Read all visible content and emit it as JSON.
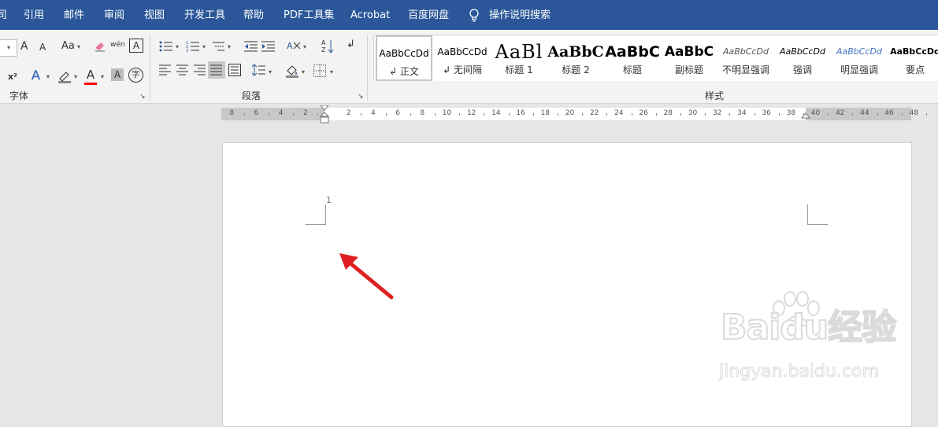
{
  "tabs": [
    "司",
    "引用",
    "邮件",
    "审阅",
    "视图",
    "开发工具",
    "帮助",
    "PDF工具集",
    "Acrobat",
    "百度网盘"
  ],
  "tell_me": "操作说明搜索",
  "groups": {
    "font": "字体",
    "paragraph": "段落",
    "styles": "样式"
  },
  "styles": [
    {
      "sample": "AaBbCcDd",
      "name": "↲ 正文"
    },
    {
      "sample": "AaBbCcDd",
      "name": "↲ 无间隔"
    },
    {
      "sample": "AaBl",
      "name": "标题 1"
    },
    {
      "sample": "AaBbC",
      "name": "标题 2"
    },
    {
      "sample": "AaBbC",
      "name": "标题"
    },
    {
      "sample": "AaBbC",
      "name": "副标题"
    },
    {
      "sample": "AaBbCcDd",
      "name": "不明显强调"
    },
    {
      "sample": "AaBbCcDd",
      "name": "强调"
    },
    {
      "sample": "AaBbCcDd",
      "name": "明显强调"
    },
    {
      "sample": "AaBbCcDd",
      "name": "要点"
    }
  ],
  "ruler_labels": [
    "8",
    "6",
    "4",
    "2",
    "2",
    "4",
    "6",
    "8",
    "10",
    "12",
    "14",
    "16",
    "18",
    "20",
    "22",
    "24",
    "26",
    "28",
    "30",
    "32",
    "34",
    "36",
    "38",
    "40",
    "42",
    "44",
    "46",
    "48"
  ],
  "page_number": "1",
  "font_icons": {
    "grow": "A",
    "shrink": "A",
    "case": "Aa",
    "superscript": "x²",
    "phonetic": "wén",
    "char_border": "A",
    "font_color": "A",
    "char_shading": "A",
    "enclose": "字"
  },
  "watermark": {
    "logo": "Baidu经验",
    "url": "jingyan.baidu.com"
  },
  "colors": {
    "ribbon_blue": "#2b579a",
    "font_color_red": "#ff0000",
    "arrow_red": "#e02020",
    "subtle_emphasis_blue": "#4472c4"
  }
}
